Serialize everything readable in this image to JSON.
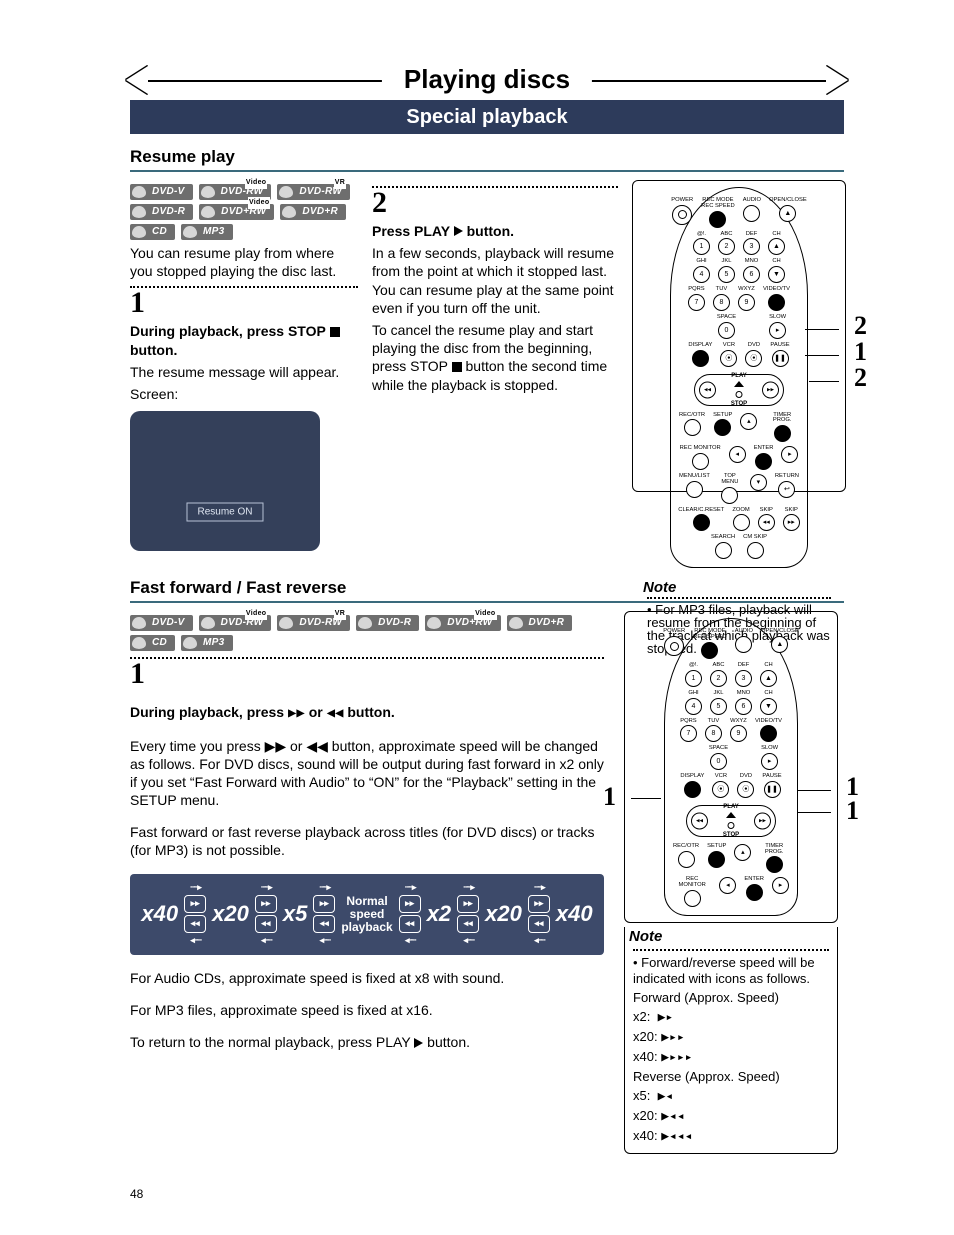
{
  "page_number": "48",
  "banner_title": "Playing discs",
  "subbar": "Special playback",
  "resume": {
    "heading": "Resume play",
    "badges_row1": [
      "DVD-V",
      "DVD-RW",
      "DVD-RW"
    ],
    "badges_row1_sup": [
      "",
      "Video",
      "VR"
    ],
    "badges_row2": [
      "DVD-R",
      "DVD+RW",
      "DVD+R"
    ],
    "badges_row2_sup": [
      "",
      "Video",
      ""
    ],
    "badges_row3": [
      "CD",
      "MP3"
    ],
    "intro": "You can resume play from where you stopped playing the disc last.",
    "step1_num": "1",
    "step1_bold_a": "During playback, press STOP",
    "step1_bold_b": " button.",
    "step1_body": "The resume message will appear.",
    "step1_screen_label": "Screen:",
    "resume_on": "Resume ON",
    "step2_num": "2",
    "step2_bold": "Press PLAY ",
    "step2_bold_tail": " button.",
    "step2_body1": "In a few seconds, playback will resume from the point at which it stopped last. You can resume play at the same point even if you turn off the unit.",
    "step2_body2": "To cancel the resume play and start playing the disc from the beginning, press STOP ",
    "step2_body2_tail": " button the second time while the playback is stopped.",
    "note_title": "Note",
    "note_body": "For MP3 files, playback will resume from the beginning of the track at which playback was stopped."
  },
  "remote": {
    "row1": [
      "POWER",
      "REC MODE\nREC SPEED",
      "AUDIO",
      "OPEN/CLOSE"
    ],
    "row2": [
      "@!.",
      "ABC",
      "DEF",
      "CH"
    ],
    "row2n": [
      "1",
      "2",
      "3",
      "▲"
    ],
    "row3": [
      "GHI",
      "JKL",
      "MNO",
      "CH"
    ],
    "row3n": [
      "4",
      "5",
      "6",
      "▼"
    ],
    "row4": [
      "PQRS",
      "TUV",
      "WXYZ",
      "VIDEO/TV"
    ],
    "row4n": [
      "7",
      "8",
      "9",
      ""
    ],
    "row5lab": "SPACE",
    "row5n": "0",
    "row5b": "SLOW",
    "row6": [
      "DISPLAY",
      "VCR",
      "DVD",
      "PAUSE"
    ],
    "pad_play": "PLAY",
    "pad_stop": "STOP",
    "row7": [
      "REC/OTR",
      "SETUP",
      "",
      "TIMER PROG."
    ],
    "row8": [
      "REC MONITOR",
      "",
      "ENTER",
      ""
    ],
    "row9": [
      "MENU/LIST",
      "TOP MENU",
      "",
      "RETURN"
    ],
    "row10": [
      "CLEAR/C.RESET",
      "ZOOM",
      "SKIP",
      "SKIP"
    ],
    "row11": [
      "SEARCH",
      "CM SKIP"
    ],
    "callout_2a": "2",
    "callout_1": "1",
    "callout_2b": "2"
  },
  "ff": {
    "heading": "Fast forward / Fast reverse",
    "badges1": [
      "DVD-V",
      "DVD-RW",
      "DVD-RW",
      "DVD-R",
      "DVD+RW",
      "DVD+R"
    ],
    "badges1_sup": [
      "",
      "Video",
      "VR",
      "",
      "Video",
      ""
    ],
    "badges2": [
      "CD",
      "MP3"
    ],
    "step1_num": "1",
    "step1_bold_a": "During playback, press ",
    "step1_bold_mid": " or ",
    "step1_bold_b": " button.",
    "body1": "Every time you press ▶▶ or ◀◀ button, approximate speed will be changed as follows. For DVD discs, sound will be output during fast forward in x2 only if you set “Fast Forward with Audio” to “ON” for the “Playback” setting in the SETUP menu.",
    "body2": "Fast forward or fast reverse playback across titles (for DVD discs) or tracks (for MP3) is not possible.",
    "speeds_left": [
      "x40",
      "x20",
      "x5"
    ],
    "center_label": "Normal\nspeed\nplayback",
    "speeds_right": [
      "x2",
      "x20",
      "x40"
    ],
    "post1": "For Audio CDs, approximate speed is fixed at x8 with sound.",
    "post2": "For MP3 files, approximate speed is fixed at x16.",
    "post3": "To return to the normal playback, press PLAY ",
    "post3_tail": " button.",
    "note_title": "Note",
    "note_line1": "Forward/reverse speed will be indicated with icons as follows.",
    "note_fwd": "Forward (Approx. Speed)",
    "note_f2": "x2:",
    "note_f20": "x20:",
    "note_f40": "x40:",
    "note_rev": "Reverse (Approx. Speed)",
    "note_r5": "x5:",
    "note_r20": "x20:",
    "note_r40": "x40:",
    "callout_1_left": "1",
    "callout_1_rightA": "1",
    "callout_1_rightB": "1"
  }
}
